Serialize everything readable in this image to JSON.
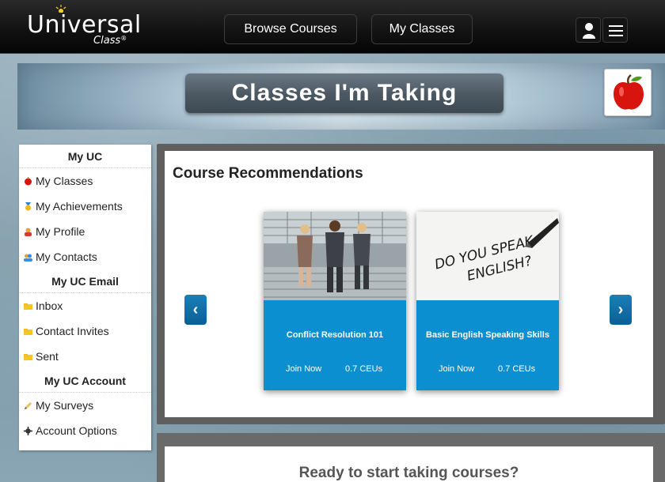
{
  "header": {
    "logo_text": "Universal",
    "logo_sub": "Class",
    "logo_mark": "®",
    "nav_browse": "Browse Courses",
    "nav_classes": "My Classes"
  },
  "banner": {
    "title": "Classes I'm Taking"
  },
  "sidebar": {
    "sections": [
      {
        "heading": "My UC",
        "items": [
          {
            "label": "My Classes",
            "icon": "apple-icon"
          },
          {
            "label": "My Achievements",
            "icon": "medal-icon"
          },
          {
            "label": "My Profile",
            "icon": "profile-icon"
          },
          {
            "label": "My Contacts",
            "icon": "contacts-icon"
          }
        ]
      },
      {
        "heading": "My UC Email",
        "items": [
          {
            "label": "Inbox",
            "icon": "folder-icon"
          },
          {
            "label": "Contact Invites",
            "icon": "folder-icon"
          },
          {
            "label": "Sent",
            "icon": "folder-icon"
          }
        ]
      },
      {
        "heading": "My UC Account",
        "items": [
          {
            "label": "My Surveys",
            "icon": "pencil-icon"
          },
          {
            "label": "Account Options",
            "icon": "gear-icon"
          }
        ]
      }
    ]
  },
  "recommendations": {
    "title": "Course Recommendations",
    "cards": [
      {
        "name": "Conflict Resolution 101",
        "join": "Join Now",
        "ceus": "0.7 CEUs"
      },
      {
        "name": "Basic English Speaking Skills",
        "join": "Join Now",
        "ceus": "0.7 CEUs",
        "image_text_line1": "DO YOU SPEAK",
        "image_text_line2": "ENGLISH?"
      }
    ]
  },
  "ready": {
    "text": "Ready to start taking courses?"
  },
  "colors": {
    "accent_blue": "#0b8fd0",
    "topbar": "#111111",
    "banner_title_bg": "#4b5862"
  }
}
